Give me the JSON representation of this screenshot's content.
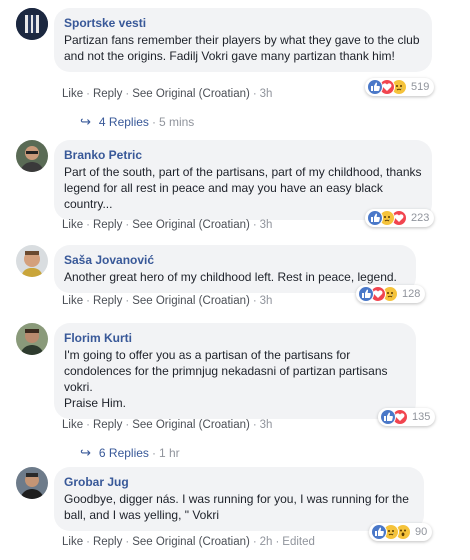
{
  "labels": {
    "like": "Like",
    "reply": "Reply",
    "see_original": "See Original (Croatian)",
    "sep": "·",
    "edited": "Edited"
  },
  "comments": [
    {
      "author": "Sportske vesti",
      "text": "Partizan fans remember their players by what they gave to the club and not the origins. Fadilj Vokri gave many partizan thank him!",
      "time": "3h",
      "reaction_count": "519",
      "reactions": [
        "like",
        "love",
        "sad"
      ],
      "replies": {
        "label": "4 Replies",
        "time": "5 mins"
      }
    },
    {
      "author": "Branko Petric",
      "text": "Part of the south, part of the partisans, part of my childhood, thanks legend for all rest in peace and may you have an easy black country...",
      "time": "3h",
      "reaction_count": "223",
      "reactions": [
        "like",
        "sad",
        "love"
      ]
    },
    {
      "author": "Saša Jovanović",
      "text": "Another great hero of my childhood left. Rest in peace, legend.",
      "time": "3h",
      "reaction_count": "128",
      "reactions": [
        "like",
        "love",
        "sad"
      ]
    },
    {
      "author": "Florim Kurti",
      "text": "I'm going to offer you as a partisan of the partisans for condolences for the primnjug nekadasni of partizan partisans vokri.\nPraise Him.",
      "time": "3h",
      "reaction_count": "135",
      "reactions": [
        "like",
        "love"
      ],
      "replies": {
        "label": "6 Replies",
        "time": "1 hr"
      }
    },
    {
      "author": "Grobar Jug",
      "text": "Goodbye, digger nás. I was running for you, I was running for the ball, and I was yelling, \" Vokri",
      "time": "2h",
      "reaction_count": "90",
      "reactions": [
        "like",
        "sad",
        "wow"
      ]
    }
  ],
  "colors": {
    "author": "#385898",
    "bubble": "#f2f3f5",
    "like": "#4a78c8",
    "love": "#f1454f",
    "sad": "#f5c33b"
  }
}
